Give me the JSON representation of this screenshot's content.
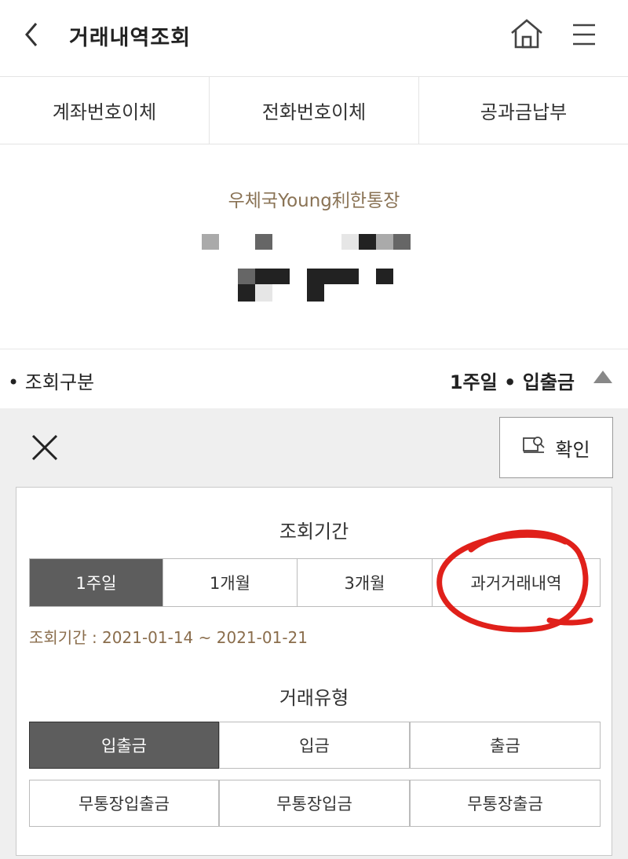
{
  "header": {
    "title": "거래내역조회",
    "back_icon": "chevron-left-icon",
    "home_icon": "home-icon",
    "menu_icon": "hamburger-menu-icon"
  },
  "quick_tabs": [
    {
      "label": "계좌번호이체"
    },
    {
      "label": "전화번호이체"
    },
    {
      "label": "공과금납부"
    }
  ],
  "account": {
    "name": "우체국Young利한통장"
  },
  "query_summary": {
    "label": "• 조회구분",
    "value": "1주일  • 입출금"
  },
  "panel": {
    "confirm_label": "확인",
    "period": {
      "title": "조회기간",
      "options": [
        {
          "label": "1주일",
          "active": true
        },
        {
          "label": "1개월",
          "active": false
        },
        {
          "label": "3개월",
          "active": false
        },
        {
          "label": "과거거래내역",
          "active": false
        }
      ],
      "range_text": "조회기간 : 2021-01-14  ~  2021-01-21"
    },
    "type": {
      "title": "거래유형",
      "row1": [
        {
          "label": "입출금",
          "active": true
        },
        {
          "label": "입금",
          "active": false
        },
        {
          "label": "출금",
          "active": false
        }
      ],
      "row2": [
        {
          "label": "무통장입출금",
          "active": false
        },
        {
          "label": "무통장입금",
          "active": false
        },
        {
          "label": "무통장출금",
          "active": false
        }
      ]
    }
  },
  "colors": {
    "accent_brown": "#8a7355",
    "active_button": "#5d5d5d",
    "annotation_red": "#e0201a"
  }
}
